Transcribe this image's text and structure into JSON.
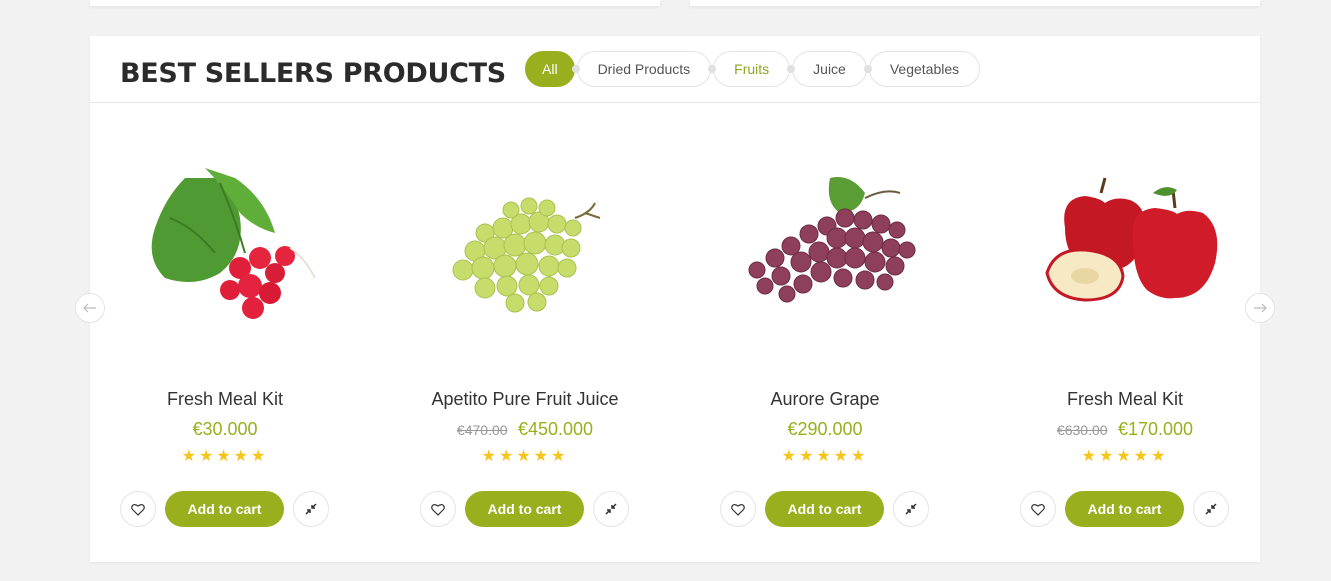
{
  "section": {
    "title": "BEST SELLERS PRODUCTS"
  },
  "tabs": [
    {
      "label": "All",
      "state": "active"
    },
    {
      "label": "Dried Products",
      "state": "normal"
    },
    {
      "label": "Fruits",
      "state": "highlight"
    },
    {
      "label": "Juice",
      "state": "normal"
    },
    {
      "label": "Vegetables",
      "state": "normal"
    }
  ],
  "products": [
    {
      "name": "Fresh Meal Kit",
      "old_price": "",
      "price": "€30.000",
      "rating": 5,
      "image": "radish-bunch",
      "stars": "★★★★★",
      "cart_label": "Add to cart"
    },
    {
      "name": "Apetito Pure Fruit Juice",
      "old_price": "€470.00",
      "price": "€450.000",
      "rating": 5,
      "image": "green-grapes",
      "stars": "★★★★★",
      "cart_label": "Add to cart"
    },
    {
      "name": "Aurore Grape",
      "old_price": "",
      "price": "€290.000",
      "rating": 5,
      "image": "red-grapes",
      "stars": "★★★★★",
      "cart_label": "Add to cart"
    },
    {
      "name": "Fresh Meal Kit",
      "old_price": "€630.00",
      "price": "€170.000",
      "rating": 5,
      "image": "red-apples",
      "stars": "★★★★★",
      "cart_label": "Add to cart"
    }
  ],
  "icons": {
    "wishlist": "heart-icon",
    "compare": "compare-arrows-icon",
    "prev": "arrow-left-icon",
    "next": "arrow-right-icon"
  },
  "colors": {
    "accent": "#9aaf1e",
    "star": "#f4c51a",
    "background": "#f2f2f2"
  }
}
